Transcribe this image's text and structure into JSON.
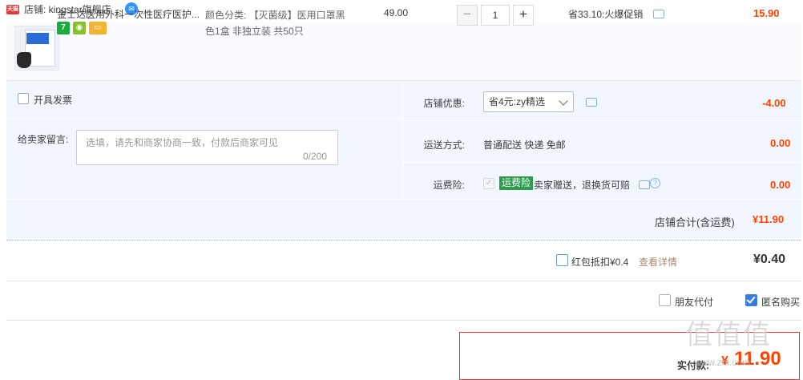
{
  "header": {
    "mall_badge": "天猫",
    "shop_label": "店铺: kingstar旗舰店"
  },
  "item": {
    "title": "金士达医用外科一次性医疗医护...",
    "sku_line1": "颜色分类: 【灭菌级】医用口罩黑",
    "sku_line2": "色1盒 非独立装 共50只",
    "unit_price": "49.00",
    "quantity": "1",
    "qty_minus": "−",
    "qty_plus": "+",
    "promotion": "省33.10:火爆促销",
    "total": "15.90",
    "thumb_text": "医用口罩"
  },
  "invoice": {
    "label": "开具发票"
  },
  "message": {
    "label": "给卖家留言:",
    "placeholder": "选填，请先和商家协商一致，付款后商家可见",
    "count": "0/200"
  },
  "coupon": {
    "label": "店铺优惠:",
    "selected": "省4元:zy精选",
    "amount": "-4.00"
  },
  "shipping": {
    "label": "运送方式:",
    "value": "普通配送 快递 免邮",
    "fee": "0.00"
  },
  "insurance": {
    "label": "运费险:",
    "tag": "运费险",
    "desc": "卖家赠送，退换货可赔",
    "fee": "0.00"
  },
  "shop_total": {
    "label": "店铺合计(含运费)",
    "value": "¥11.90"
  },
  "red_packet": {
    "label": "红包抵扣¥0.4",
    "link": "查看详情",
    "value": "¥0.40"
  },
  "options": {
    "friend_pay": "朋友代付",
    "anonymous": "匿名购买"
  },
  "pay": {
    "label": "实付款:",
    "currency": "¥",
    "value": "11.90"
  },
  "watermark": {
    "logo": "值值值",
    "site": "www.zhi.com"
  },
  "colors": {
    "price_red": "#ff4400",
    "panel_blue": "#f2f7ff",
    "accent_blue": "#3b7ddd",
    "insurance_green": "#2e9b4e",
    "border_red": "#e4393c"
  }
}
